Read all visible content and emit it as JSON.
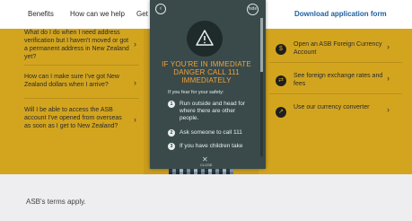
{
  "nav": {
    "links": [
      "Benefits",
      "How can we help",
      "Get s"
    ],
    "cta": "Download application form"
  },
  "faq": [
    "What do I do when I need address verification but I haven't moved or got a permanent address in New Zealand yet?",
    "How can I make sure I've got New Zealand dollars when I arrive?",
    "Will I be able to access the ASB account I've opened from overseas as soon as I get to New Zealand?"
  ],
  "related": [
    {
      "label": "Open an ASB Foreign Currency Account",
      "icon": "currency-icon"
    },
    {
      "label": "See foreign exchange rates and fees",
      "icon": "exchange-icon"
    },
    {
      "label": "Use our currency converter",
      "icon": "converter-icon"
    }
  ],
  "footer": {
    "terms": "ASB's terms apply."
  },
  "overlay": {
    "heading": "IF YOU'RE IN IMMEDIATE DANGER CALL 111 IMMEDIATELY",
    "lead": "If you fear for your safety:",
    "steps": [
      {
        "n": "1",
        "text": "Run outside and head for where there are other people."
      },
      {
        "n": "2",
        "text": "Ask someone to call 111"
      },
      {
        "n": "3",
        "text": "If you have children take"
      }
    ],
    "close_label": "CLOSE",
    "back_glyph": "‹",
    "hide_glyph": "hide",
    "accent": "#f0a23a",
    "background": "#3a4a4a"
  },
  "chevron": "›"
}
